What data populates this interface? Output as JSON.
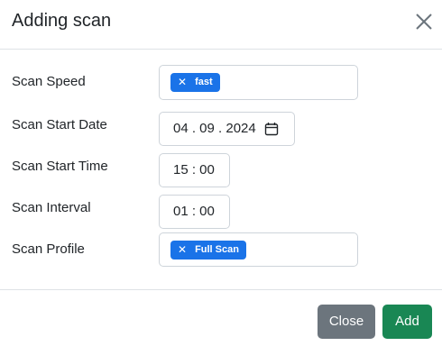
{
  "modal": {
    "title": "Adding scan",
    "close_icon": "close-x-icon"
  },
  "fields": {
    "scan_speed": {
      "label": "Scan Speed",
      "tag": "fast",
      "tag_remove_glyph": "✕"
    },
    "scan_start_date": {
      "label": "Scan Start Date",
      "value": "04 . 09 . 2024",
      "icon": "calendar-icon"
    },
    "scan_start_time": {
      "label": "Scan Start Time",
      "value": "15 : 00"
    },
    "scan_interval": {
      "label": "Scan Interval",
      "value": "01 : 00"
    },
    "scan_profile": {
      "label": "Scan Profile",
      "tag": "Full Scan",
      "tag_remove_glyph": "✕"
    }
  },
  "footer": {
    "close_label": "Close",
    "add_label": "Add"
  },
  "colors": {
    "tag_bg": "#1a73e8",
    "close_btn": "#6c757d",
    "add_btn": "#198754"
  }
}
